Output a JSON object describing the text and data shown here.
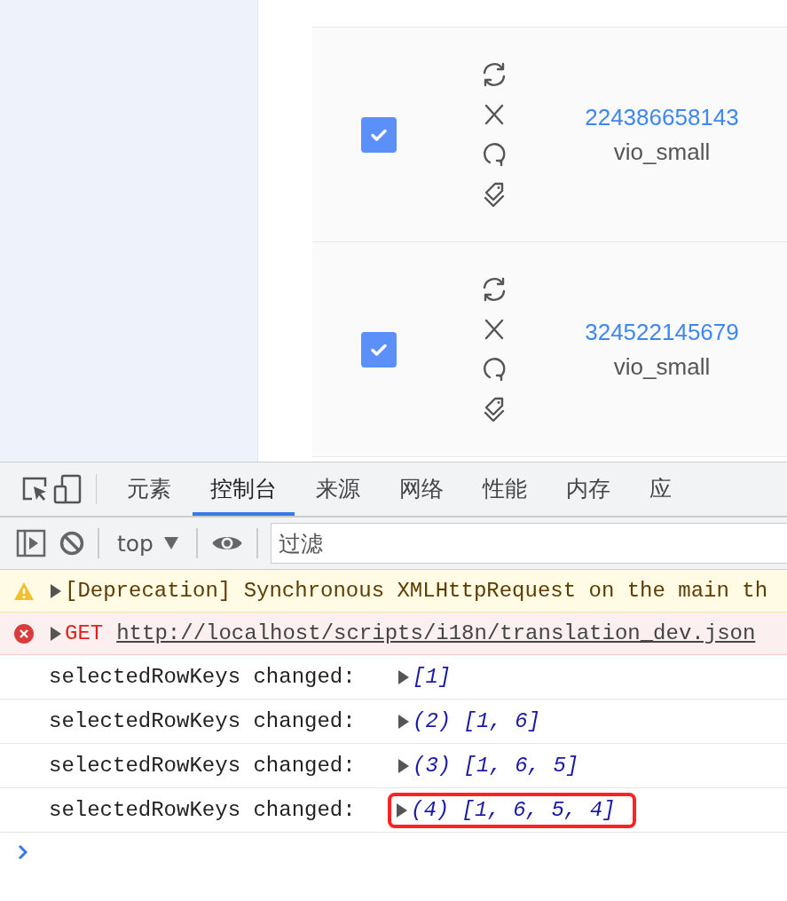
{
  "table": {
    "rows": [
      {
        "selected": true,
        "id": "224386658143",
        "name": "vio_small"
      },
      {
        "selected": true,
        "id": "324522145679",
        "name": "vio_small"
      }
    ]
  },
  "devtools": {
    "tabs": [
      {
        "label": "元素",
        "selected": false
      },
      {
        "label": "控制台",
        "selected": true
      },
      {
        "label": "来源",
        "selected": false
      },
      {
        "label": "网络",
        "selected": false
      },
      {
        "label": "性能",
        "selected": false
      },
      {
        "label": "内存",
        "selected": false
      },
      {
        "label": "应",
        "selected": false
      }
    ],
    "context": "top",
    "filter": {
      "placeholder": "过滤"
    },
    "messages": [
      {
        "kind": "warning",
        "text": "[Deprecation] Synchronous XMLHttpRequest on the main th"
      },
      {
        "kind": "error",
        "method": "GET",
        "url": "http://localhost/scripts/i18n/translation_dev.json"
      },
      {
        "kind": "log",
        "text": "selectedRowKeys changed:",
        "value": "[1]",
        "highlighted": false
      },
      {
        "kind": "log",
        "text": "selectedRowKeys changed:",
        "value": "(2) [1, 6]",
        "highlighted": false
      },
      {
        "kind": "log",
        "text": "selectedRowKeys changed:",
        "value": "(3) [1, 6, 5]",
        "highlighted": false
      },
      {
        "kind": "log",
        "text": "selectedRowKeys changed:",
        "value": "(4) [1, 6, 5, 4]",
        "highlighted": true
      }
    ]
  }
}
